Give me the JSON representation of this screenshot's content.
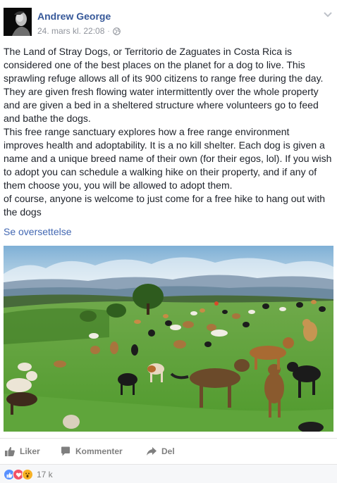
{
  "post": {
    "author": "Andrew George",
    "timestamp": "24. mars kl. 22:08",
    "separator": "·",
    "privacy_icon": "globe-icon",
    "menu_icon": "chevron-down-icon",
    "paragraphs": [
      "The Land of Stray Dogs, or Territorio de Zaguates in Costa Rica is considered one of the best places on the planet for a dog to live. This sprawling refuge allows all of its 900 citizens to range free during the day. They are given fresh flowing water intermittently over the whole property and are given a bed in a sheltered structure where volunteers go to feed and bathe the dogs.",
      "This free range sanctuary explores how a free range environment improves health and adoptability. It is a no kill shelter. Each dog is given a name and a unique breed name of their own (for their egos, lol). If you wish to adopt you can schedule a walking hike on their property, and if any of them choose you, you will be allowed to adopt them.",
      "of course, anyone is welcome to just come for a free hike to hang out with the dogs"
    ],
    "translate_link": "Se oversettelse"
  },
  "actions": {
    "like": "Liker",
    "comment": "Kommenter",
    "share": "Del"
  },
  "reactions": {
    "types": [
      "like",
      "love",
      "wow"
    ],
    "count": "17 k"
  },
  "colors": {
    "link_blue": "#365899",
    "translate_blue": "#4267b2",
    "muted_text": "#90949c",
    "action_grey": "#7f7f7f"
  }
}
